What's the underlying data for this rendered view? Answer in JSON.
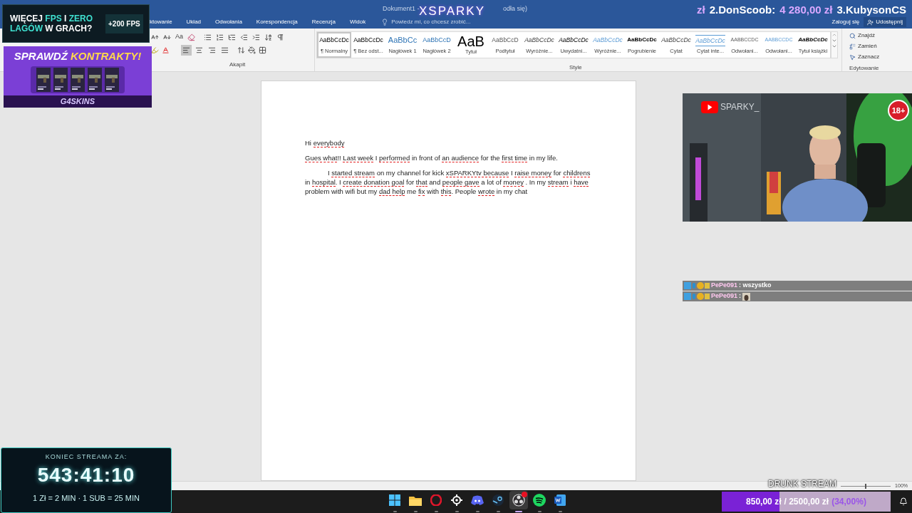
{
  "window": {
    "title": "Dokument1 -",
    "title_end": "odła się)"
  },
  "stream_title": "XSPARKY",
  "leaderboard": [
    {
      "text": "zł",
      "kind": "amount"
    },
    {
      "text": "2.DonScoob:",
      "kind": "name"
    },
    {
      "text": "4 280,00 zł",
      "kind": "amount"
    },
    {
      "text": "3.KubysonCS",
      "kind": "name"
    }
  ],
  "ribbon_tabs": [
    "ktowanie",
    "Układ",
    "Odwołania",
    "Korespondencja",
    "Recenzja",
    "Widok"
  ],
  "tell_me": "Powiedz mi, co chcesz zrobić...",
  "account": {
    "sign_in": "Zaloguj się",
    "share": "Udostępnij"
  },
  "font_case": "Aa",
  "alignments": [
    {
      "kind": "left",
      "selected": true
    },
    {
      "kind": "center",
      "selected": false
    },
    {
      "kind": "right",
      "selected": false
    },
    {
      "kind": "justify",
      "selected": false
    }
  ],
  "styles": [
    {
      "sample": "AaBbCcDc",
      "name": "¶ Normalny",
      "kind": "normal",
      "selected": true
    },
    {
      "sample": "AaBbCcDc",
      "name": "¶ Bez odst...",
      "kind": "normal",
      "selected": false
    },
    {
      "sample": "AaBbCc",
      "name": "Nagłówek 1",
      "kind": "heading1",
      "selected": false
    },
    {
      "sample": "AaBbCcD",
      "name": "Nagłówek 2",
      "kind": "heading2",
      "selected": false
    },
    {
      "sample": "AaB",
      "name": "Tytuł",
      "kind": "title",
      "selected": false
    },
    {
      "sample": "AaBbCcD",
      "name": "Podtytuł",
      "kind": "subtitle",
      "selected": false
    },
    {
      "sample": "AaBbCcDc",
      "name": "Wyróżnie...",
      "kind": "subtle",
      "selected": false
    },
    {
      "sample": "AaBbCcDc",
      "name": "Uwydatni...",
      "kind": "emphasis",
      "selected": false
    },
    {
      "sample": "AaBbCcDc",
      "name": "Wyróżnie...",
      "kind": "intense",
      "selected": false
    },
    {
      "sample": "AaBbCcDc",
      "name": "Pogrubienie",
      "kind": "strong",
      "selected": false
    },
    {
      "sample": "AaBbCcDc",
      "name": "Cytat",
      "kind": "quote",
      "selected": false
    },
    {
      "sample": "AaBbCcDc",
      "name": "Cytat inte...",
      "kind": "intense_quote",
      "selected": false
    },
    {
      "sample": "AABBCCDC",
      "name": "Odwołani...",
      "kind": "reference",
      "selected": false
    },
    {
      "sample": "AABBCCDC",
      "name": "Odwołani...",
      "kind": "intense_reference",
      "selected": false
    },
    {
      "sample": "AaBbCcDc",
      "name": "Tytuł książki",
      "kind": "book",
      "selected": false
    }
  ],
  "group_labels": [
    "Akapit",
    "Style",
    "Edytowanie"
  ],
  "editing": [
    "Znajdź",
    "Zamień",
    "Zaznacz"
  ],
  "document": [
    {
      "indent": false,
      "segments": [
        {
          "text": "Hi ",
          "flagged": false
        },
        {
          "text": "everybody",
          "flagged": true
        }
      ]
    },
    {
      "indent": false,
      "segments": [
        {
          "text": "Gues what",
          "flagged": true
        },
        {
          "text": "!! ",
          "flagged": false
        },
        {
          "text": "Last week",
          "flagged": true
        },
        {
          "text": " I ",
          "flagged": false
        },
        {
          "text": "performed",
          "flagged": true
        },
        {
          "text": " in front of ",
          "flagged": false
        },
        {
          "text": "an audience",
          "flagged": true
        },
        {
          "text": " for the ",
          "flagged": false
        },
        {
          "text": "first time",
          "flagged": true
        },
        {
          "text": " in my life.",
          "flagged": false
        }
      ]
    },
    {
      "indent": true,
      "segments": [
        {
          "text": "I ",
          "flagged": false
        },
        {
          "text": "started stream",
          "flagged": true
        },
        {
          "text": " on my channel for kick ",
          "flagged": false
        },
        {
          "text": "xSPARKYtv because",
          "flagged": true
        },
        {
          "text": " I ",
          "flagged": false
        },
        {
          "text": "raise money",
          "flagged": true
        },
        {
          "text": " for ",
          "flagged": false
        },
        {
          "text": "childrens",
          "flagged": true
        },
        {
          "text": " in ",
          "flagged": false
        },
        {
          "text": "hospital",
          "flagged": true
        },
        {
          "text": ". I ",
          "flagged": false
        },
        {
          "text": "create donation goal",
          "flagged": true
        },
        {
          "text": " for ",
          "flagged": false
        },
        {
          "text": "that",
          "flagged": true
        },
        {
          "text": " and ",
          "flagged": false
        },
        {
          "text": "people gave",
          "flagged": true
        },
        {
          "text": " a lot of ",
          "flagged": false
        },
        {
          "text": "money",
          "flagged": true
        },
        {
          "text": " . In my ",
          "flagged": false
        },
        {
          "text": "stream",
          "flagged": true
        },
        {
          "text": " i ",
          "flagged": false
        },
        {
          "text": "have",
          "flagged": true
        },
        {
          "text": " problem with wifi but my ",
          "flagged": false
        },
        {
          "text": "dad help",
          "flagged": true
        },
        {
          "text": " me ",
          "flagged": false
        },
        {
          "text": "fix",
          "flagged": true
        },
        {
          "text": " with ",
          "flagged": false
        },
        {
          "text": "this",
          "flagged": true
        },
        {
          "text": ". People ",
          "flagged": false
        },
        {
          "text": "wrote",
          "flagged": true
        },
        {
          "text": " in my chat",
          "flagged": false
        }
      ]
    }
  ],
  "ad_fps": {
    "segments": [
      {
        "text": "WIĘCEJ ",
        "highlight": false
      },
      {
        "text": "FPS",
        "highlight": true
      },
      {
        "text": " I ",
        "highlight": false
      },
      {
        "text": "ZERO LAGÓW",
        "highlight": true
      },
      {
        "text": " W GRACH?",
        "highlight": false
      }
    ],
    "badge": "+200 FPS"
  },
  "ad_skins": {
    "title": "SPRAWDŹ",
    "title_highlight": "KONTRAKTY!",
    "brand": "G4SKINS"
  },
  "webcam": {
    "channel": "SPARKY_",
    "age_badge": "18+"
  },
  "chat": [
    {
      "user": "PePe091",
      "message": ": wszystko",
      "kind": "text"
    },
    {
      "user": "PePe091",
      "message": ":",
      "kind": "emote"
    }
  ],
  "timer": {
    "title": "KONIEC STREAMA ZA:",
    "time": "543:41:10",
    "rules": "1 Zł = 2 MIN · 1 SUB = 25 MIN"
  },
  "status_bar": {
    "overlay": "DRUNK STREAM",
    "zoom": "100%",
    "zoom_slider": {
      "level": 0.5
    }
  },
  "taskbar": [
    {
      "kind": "windows",
      "active": false
    },
    {
      "kind": "folder",
      "active": false
    },
    {
      "kind": "opera",
      "active": false
    },
    {
      "kind": "steelseries",
      "active": false
    },
    {
      "kind": "discord",
      "active": false
    },
    {
      "kind": "steam",
      "active": false
    },
    {
      "kind": "obs",
      "active": true
    },
    {
      "kind": "spotify",
      "active": false
    },
    {
      "kind": "word",
      "active": false
    }
  ],
  "goal": {
    "current": "850,00 zł",
    "target": "/ 2500,00 zł",
    "percent": "(34,00%)",
    "level": 0.34
  }
}
